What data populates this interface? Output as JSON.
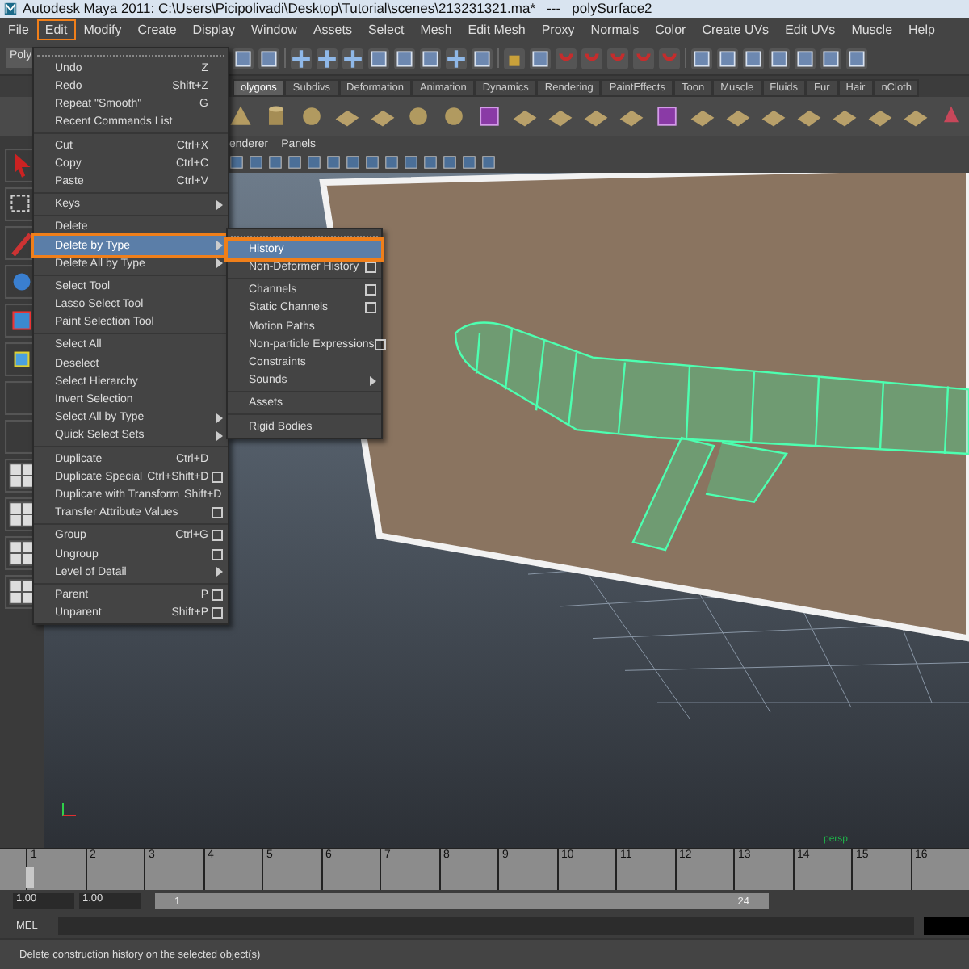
{
  "window": {
    "title": "Autodesk Maya 2011: C:\\Users\\Picipolivadi\\Desktop\\Tutorial\\scenes\\213231321.ma*   ---   polySurface2"
  },
  "menu_bar": [
    {
      "label": "File",
      "selected": false
    },
    {
      "label": "Edit",
      "selected": true
    },
    {
      "label": "Modify",
      "selected": false
    },
    {
      "label": "Create",
      "selected": false
    },
    {
      "label": "Display",
      "selected": false
    },
    {
      "label": "Window",
      "selected": false
    },
    {
      "label": "Assets",
      "selected": false
    },
    {
      "label": "Select",
      "selected": false
    },
    {
      "label": "Mesh",
      "selected": false
    },
    {
      "label": "Edit Mesh",
      "selected": false
    },
    {
      "label": "Proxy",
      "selected": false
    },
    {
      "label": "Normals",
      "selected": false
    },
    {
      "label": "Color",
      "selected": false
    },
    {
      "label": "Create UVs",
      "selected": false
    },
    {
      "label": "Edit UVs",
      "selected": false
    },
    {
      "label": "Muscle",
      "selected": false
    },
    {
      "label": "Help",
      "selected": false
    }
  ],
  "status_line": {
    "mode_menu": "Poly"
  },
  "shelf_tabs": [
    {
      "label": "olygons",
      "selected": true
    },
    {
      "label": "Subdivs",
      "selected": false
    },
    {
      "label": "Deformation",
      "selected": false
    },
    {
      "label": "Animation",
      "selected": false
    },
    {
      "label": "Dynamics",
      "selected": false
    },
    {
      "label": "Rendering",
      "selected": false
    },
    {
      "label": "PaintEffects",
      "selected": false
    },
    {
      "label": "Toon",
      "selected": false
    },
    {
      "label": "Muscle",
      "selected": false
    },
    {
      "label": "Fluids",
      "selected": false
    },
    {
      "label": "Fur",
      "selected": false
    },
    {
      "label": "Hair",
      "selected": false
    },
    {
      "label": "nCloth",
      "selected": false
    }
  ],
  "panel_menu": [
    "enderer",
    "Panels"
  ],
  "viewport": {
    "camera_label": "persp"
  },
  "edit_menu": {
    "groups": [
      [
        {
          "label": "Undo",
          "shortcut": "Z",
          "option_box": false,
          "submenu": false,
          "selected": false
        },
        {
          "label": "Redo",
          "shortcut": "Shift+Z",
          "option_box": false,
          "submenu": false,
          "selected": false
        },
        {
          "label": "Repeat \"Smooth\"",
          "shortcut": "G",
          "option_box": false,
          "submenu": false,
          "selected": false
        },
        {
          "label": "Recent Commands List",
          "option_box": false,
          "submenu": false,
          "selected": false
        }
      ],
      [
        {
          "label": "Cut",
          "shortcut": "Ctrl+X",
          "option_box": false,
          "submenu": false,
          "selected": false
        },
        {
          "label": "Copy",
          "shortcut": "Ctrl+C",
          "option_box": false,
          "submenu": false,
          "selected": false
        },
        {
          "label": "Paste",
          "shortcut": "Ctrl+V",
          "option_box": false,
          "submenu": false,
          "selected": false
        }
      ],
      [
        {
          "label": "Keys",
          "option_box": false,
          "submenu": true,
          "selected": false
        }
      ],
      [
        {
          "label": "Delete",
          "option_box": false,
          "submenu": false,
          "selected": false
        },
        {
          "label": "Delete by Type",
          "option_box": false,
          "submenu": true,
          "selected": true
        },
        {
          "label": "Delete All by Type",
          "option_box": false,
          "submenu": true,
          "selected": false
        }
      ],
      [
        {
          "label": "Select Tool",
          "option_box": false,
          "submenu": false,
          "selected": false
        },
        {
          "label": "Lasso Select Tool",
          "option_box": false,
          "submenu": false,
          "selected": false
        },
        {
          "label": "Paint Selection Tool",
          "option_box": false,
          "submenu": false,
          "selected": false
        }
      ],
      [
        {
          "label": "Select All",
          "option_box": false,
          "submenu": false,
          "selected": false
        },
        {
          "label": "Deselect",
          "option_box": false,
          "submenu": false,
          "selected": false
        },
        {
          "label": "Select Hierarchy",
          "option_box": false,
          "submenu": false,
          "selected": false
        },
        {
          "label": "Invert Selection",
          "option_box": false,
          "submenu": false,
          "selected": false
        },
        {
          "label": "Select All by Type",
          "option_box": false,
          "submenu": true,
          "selected": false
        },
        {
          "label": "Quick Select Sets",
          "option_box": false,
          "submenu": true,
          "selected": false
        }
      ],
      [
        {
          "label": "Duplicate",
          "shortcut": "Ctrl+D",
          "option_box": false,
          "submenu": false,
          "selected": false
        },
        {
          "label": "Duplicate Special",
          "shortcut": "Ctrl+Shift+D",
          "option_box": true,
          "submenu": false,
          "selected": false
        },
        {
          "label": "Duplicate with Transform",
          "shortcut": "Shift+D",
          "option_box": false,
          "submenu": false,
          "selected": false
        },
        {
          "label": "Transfer Attribute Values",
          "option_box": true,
          "submenu": false,
          "selected": false
        }
      ],
      [
        {
          "label": "Group",
          "shortcut": "Ctrl+G",
          "option_box": true,
          "submenu": false,
          "selected": false
        },
        {
          "label": "Ungroup",
          "option_box": true,
          "submenu": false,
          "selected": false
        },
        {
          "label": "Level of Detail",
          "option_box": false,
          "submenu": true,
          "selected": false
        }
      ],
      [
        {
          "label": "Parent",
          "shortcut": "P",
          "option_box": true,
          "submenu": false,
          "selected": false
        },
        {
          "label": "Unparent",
          "shortcut": "Shift+P",
          "option_box": true,
          "submenu": false,
          "selected": false
        }
      ]
    ]
  },
  "delete_by_type_menu": {
    "groups": [
      [
        {
          "label": "History",
          "option_box": false,
          "submenu": false,
          "selected": true
        },
        {
          "label": "Non-Deformer History",
          "option_box": true,
          "submenu": false,
          "selected": false
        }
      ],
      [
        {
          "label": "Channels",
          "option_box": true,
          "submenu": false,
          "selected": false
        },
        {
          "label": "Static Channels",
          "option_box": true,
          "submenu": false,
          "selected": false
        },
        {
          "label": "Motion Paths",
          "option_box": false,
          "submenu": false,
          "selected": false
        },
        {
          "label": "Non-particle Expressions",
          "option_box": true,
          "submenu": false,
          "selected": false
        },
        {
          "label": "Constraints",
          "option_box": false,
          "submenu": false,
          "selected": false
        },
        {
          "label": "Sounds",
          "option_box": false,
          "submenu": true,
          "selected": false
        }
      ],
      [
        {
          "label": "Assets",
          "option_box": false,
          "submenu": false,
          "selected": false
        }
      ],
      [
        {
          "label": "Rigid Bodies",
          "option_box": false,
          "submenu": false,
          "selected": false
        }
      ]
    ]
  },
  "time_slider": {
    "level": 0,
    "ticks": [
      "1",
      "2",
      "3",
      "4",
      "5",
      "6",
      "7",
      "8",
      "9",
      "10",
      "11",
      "12",
      "13",
      "14",
      "15",
      "16"
    ]
  },
  "range_slider": {
    "start_field": "1.00",
    "playback_start_field": "1.00",
    "range_start": "1",
    "range_end": "24"
  },
  "command_line": {
    "label": "MEL"
  },
  "help_line": {
    "text": "Delete construction history on the selected object(s)"
  }
}
